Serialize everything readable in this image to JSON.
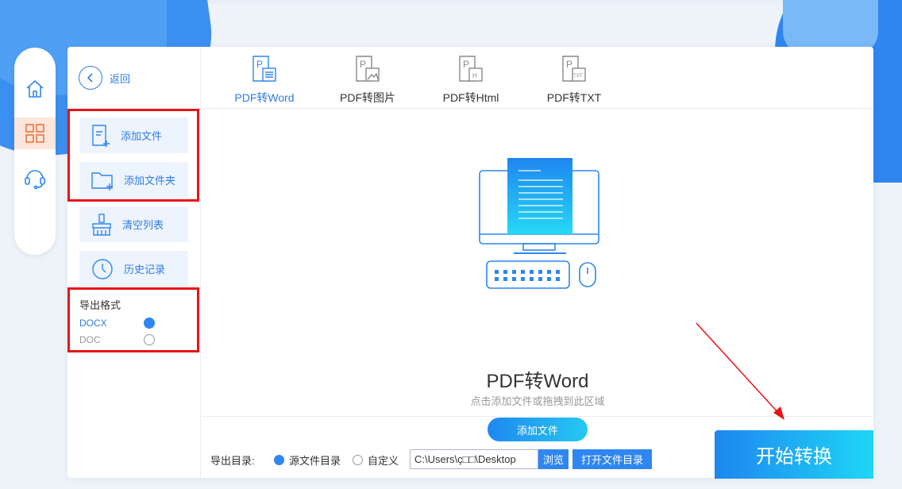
{
  "sidebar": {
    "back_label": "返回",
    "buttons": [
      {
        "label": "添加文件",
        "icon": "add-file-icon"
      },
      {
        "label": "添加文件夹",
        "icon": "add-folder-icon"
      },
      {
        "label": "清空列表",
        "icon": "broom-icon"
      },
      {
        "label": "历史记录",
        "icon": "clock-icon"
      }
    ],
    "format_title": "导出格式",
    "formats": [
      {
        "label": "DOCX",
        "selected": true
      },
      {
        "label": "DOC",
        "selected": false
      }
    ]
  },
  "rail": {
    "items": [
      "home-icon",
      "grid-icon",
      "headset-icon"
    ],
    "active": 1
  },
  "tabs": [
    {
      "label": "PDF转Word",
      "active": true
    },
    {
      "label": "PDF转图片",
      "active": false
    },
    {
      "label": "PDF转Html",
      "active": false
    },
    {
      "label": "PDF转TXT",
      "active": false
    }
  ],
  "drop": {
    "title": "PDF转Word",
    "subtitle": "点击添加文件或拖拽到此区域",
    "add_button": "添加文件"
  },
  "bottom": {
    "output_label": "导出目录:",
    "option_source": "源文件目录",
    "option_custom": "自定义",
    "path_value": "C:\\Users\\ç□□\\Desktop",
    "browse": "浏览",
    "open_dir": "打开文件目录",
    "start": "开始转换"
  },
  "colors": {
    "accent": "#2f86f0",
    "highlight": "#e8141a",
    "rail_active": "#fde6dc"
  }
}
